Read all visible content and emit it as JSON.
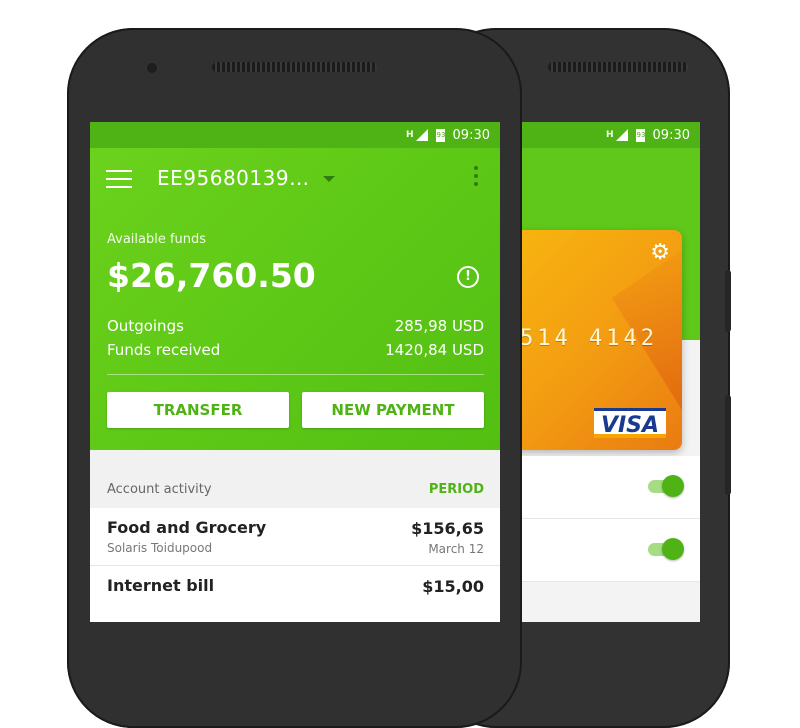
{
  "status_bar": {
    "network": "H",
    "battery": "93",
    "time": "09:30"
  },
  "header": {
    "account": "EE95680139…"
  },
  "funds": {
    "available_label": "Available funds",
    "amount": "$26,760.50",
    "outgoings_label": "Outgoings",
    "outgoings_value": "285,98 USD",
    "received_label": "Funds received",
    "received_value": "1420,84 USD"
  },
  "actions": {
    "transfer": "TRANSFER",
    "new_payment": "NEW PAYMENT"
  },
  "activity": {
    "label": "Account activity",
    "period": "PERIOD",
    "items": [
      {
        "title": "Food and Grocery",
        "subtitle": "Solaris Toidupood",
        "amount": "$156,65",
        "date": "March 12"
      },
      {
        "title": "Internet bill",
        "subtitle": "",
        "amount": "$15,00",
        "date": ""
      }
    ]
  },
  "card": {
    "number_visible": "514 4142",
    "brand": "VISA"
  },
  "colors": {
    "accent": "#4fb315",
    "hero": "#5fc81a",
    "card": "#f8b90e"
  }
}
